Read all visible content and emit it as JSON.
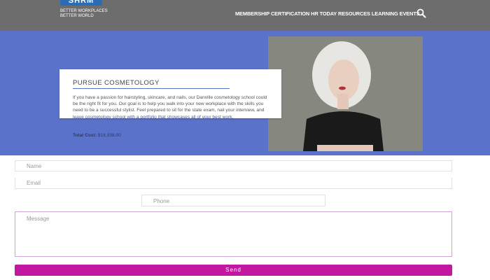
{
  "header": {
    "logo_text": "SHRM",
    "tagline_line1": "BETTER WORKPLACES",
    "tagline_line2": "BETTER WORLD",
    "nav_items": [
      "MEMBERSHIP",
      "CERTIFICATION",
      "HR TODAY",
      "RESOURCES",
      "LEARNING",
      "EVENTS"
    ],
    "search_icon": "search-icon"
  },
  "hero": {
    "background_color": "#5a72c9",
    "card_title": "PURSUE COSMETOLOGY",
    "card_body_visible": "If you have a passion for hairstyling, skincare, and nails, our Danville cosmetology school could be the right fit for you. Our goal is to help you walk into your new workplace with the skills you need to be a successful stylist. Feel prepared to sit for the state exam, nail your interview, and",
    "card_body_overflow": "leave cosmetology school with a portfolio that showcases all of your best work.",
    "total_cost_label": "Total Cost:",
    "total_cost_value": "$18,338.00"
  },
  "form": {
    "name_placeholder": "Name",
    "email_placeholder": "Email",
    "phone_placeholder": "Phone",
    "message_placeholder": "Message",
    "send_label": "Send",
    "send_color": "#c2179f"
  }
}
